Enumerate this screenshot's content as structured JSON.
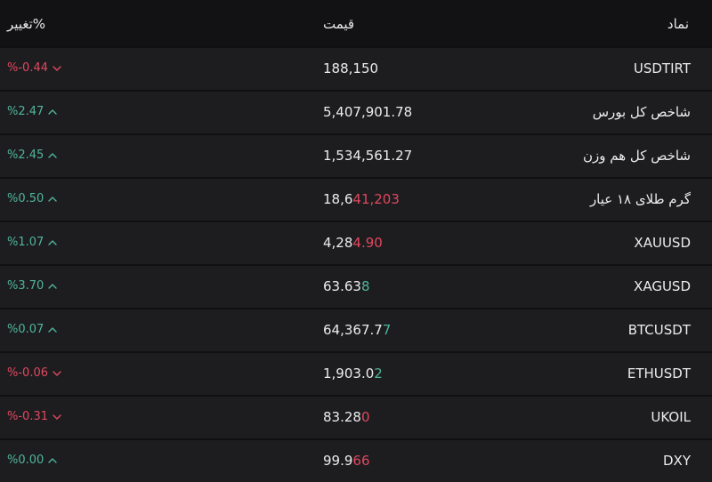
{
  "header": {
    "symbol": "نماد",
    "price": "قیمت",
    "change": "تغییر%"
  },
  "rows": [
    {
      "symbol": "USDTIRT",
      "price_main": "188,150",
      "price_tail": "",
      "tail_dir": "up",
      "change": "%-0.44",
      "dir": "down"
    },
    {
      "symbol": "شاخص کل بورس",
      "price_main": "5,407,901.78",
      "price_tail": "",
      "tail_dir": "up",
      "change": "%2.47",
      "dir": "up"
    },
    {
      "symbol": "شاخص کل هم وزن",
      "price_main": "1,534,561.27",
      "price_tail": "",
      "tail_dir": "up",
      "change": "%2.45",
      "dir": "up"
    },
    {
      "symbol": "گرم طلای ۱۸ عیار",
      "price_main": "18,6",
      "price_tail": "41,203",
      "tail_dir": "down",
      "change": "%0.50",
      "dir": "up"
    },
    {
      "symbol": "XAUUSD",
      "price_main": "4,28",
      "price_tail": "4.90",
      "tail_dir": "down",
      "change": "%1.07",
      "dir": "up"
    },
    {
      "symbol": "XAGUSD",
      "price_main": "63.63",
      "price_tail": "8",
      "tail_dir": "up",
      "change": "%3.70",
      "dir": "up"
    },
    {
      "symbol": "BTCUSDT",
      "price_main": "64,367.7",
      "price_tail": "7",
      "tail_dir": "up",
      "change": "%0.07",
      "dir": "up"
    },
    {
      "symbol": "ETHUSDT",
      "price_main": "1,903.0",
      "price_tail": "2",
      "tail_dir": "up",
      "change": "%-0.06",
      "dir": "down"
    },
    {
      "symbol": "UKOIL",
      "price_main": "83.28",
      "price_tail": "0",
      "tail_dir": "down",
      "change": "%-0.31",
      "dir": "down"
    },
    {
      "symbol": "DXY",
      "price_main": "99.9",
      "price_tail": "66",
      "tail_dir": "down",
      "change": "%0.00",
      "dir": "up"
    }
  ],
  "colors": {
    "up": "#4fb597",
    "down": "#e0485e",
    "background": "#161618",
    "row": "#1d1d20"
  },
  "icons": {
    "up": "chevron-up-icon",
    "down": "chevron-down-icon"
  }
}
